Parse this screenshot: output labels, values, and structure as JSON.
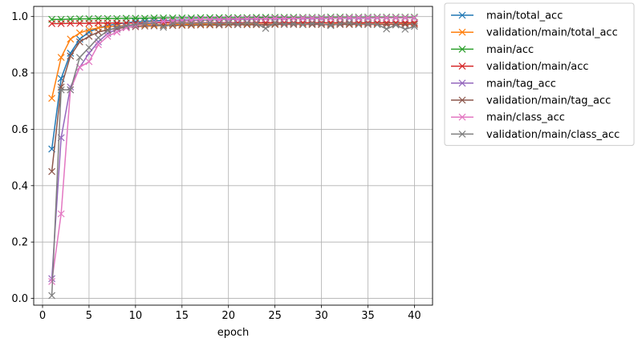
{
  "chart_data": {
    "type": "line",
    "title": "",
    "xlabel": "epoch",
    "ylabel": "",
    "xlim": [
      -0.95,
      41.95
    ],
    "ylim": [
      -0.024,
      1.036
    ],
    "xticks": [
      0,
      5,
      10,
      15,
      20,
      25,
      30,
      35,
      40
    ],
    "yticks": [
      0.0,
      0.2,
      0.4,
      0.6,
      0.8,
      1.0
    ],
    "grid": true,
    "marker": "x",
    "legend_position": "outside upper right",
    "x": [
      1,
      2,
      3,
      4,
      5,
      6,
      7,
      8,
      9,
      10,
      11,
      12,
      13,
      14,
      15,
      16,
      17,
      18,
      19,
      20,
      21,
      22,
      23,
      24,
      25,
      26,
      27,
      28,
      29,
      30,
      31,
      32,
      33,
      34,
      35,
      36,
      37,
      38,
      39,
      40
    ],
    "series": [
      {
        "name": "main/total_acc",
        "color": "#1f77b4",
        "values": [
          0.53,
          0.78,
          0.87,
          0.92,
          0.945,
          0.96,
          0.968,
          0.974,
          0.978,
          0.981,
          0.983,
          0.985,
          0.986,
          0.987,
          0.988,
          0.989,
          0.99,
          0.99,
          0.991,
          0.991,
          0.992,
          0.992,
          0.992,
          0.993,
          0.993,
          0.993,
          0.994,
          0.994,
          0.994,
          0.994,
          0.995,
          0.995,
          0.995,
          0.995,
          0.995,
          0.996,
          0.996,
          0.996,
          0.996,
          0.996
        ]
      },
      {
        "name": "validation/main/total_acc",
        "color": "#ff7f0e",
        "values": [
          0.71,
          0.855,
          0.92,
          0.942,
          0.953,
          0.96,
          0.964,
          0.966,
          0.968,
          0.97,
          0.971,
          0.972,
          0.971,
          0.973,
          0.972,
          0.973,
          0.974,
          0.973,
          0.974,
          0.972,
          0.973,
          0.975,
          0.973,
          0.972,
          0.974,
          0.973,
          0.975,
          0.973,
          0.974,
          0.972,
          0.973,
          0.974,
          0.973,
          0.975,
          0.973,
          0.974,
          0.972,
          0.973,
          0.974,
          0.973
        ]
      },
      {
        "name": "main/acc",
        "color": "#2ca02c",
        "values": [
          0.99,
          0.99,
          0.991,
          0.992,
          0.992,
          0.993,
          0.993,
          0.993,
          0.994,
          0.994,
          0.994,
          0.995,
          0.995,
          0.995,
          0.995,
          0.995,
          0.996,
          0.996,
          0.996,
          0.996,
          0.996,
          0.996,
          0.997,
          0.997,
          0.997,
          0.997,
          0.997,
          0.997,
          0.997,
          0.997,
          0.998,
          0.998,
          0.998,
          0.998,
          0.998,
          0.998,
          0.998,
          0.998,
          0.998,
          0.998
        ]
      },
      {
        "name": "validation/main/acc",
        "color": "#d62728",
        "values": [
          0.975,
          0.975,
          0.976,
          0.976,
          0.976,
          0.977,
          0.977,
          0.977,
          0.977,
          0.977,
          0.977,
          0.978,
          0.978,
          0.978,
          0.978,
          0.978,
          0.978,
          0.978,
          0.978,
          0.978,
          0.978,
          0.978,
          0.978,
          0.978,
          0.978,
          0.978,
          0.978,
          0.978,
          0.978,
          0.978,
          0.978,
          0.978,
          0.978,
          0.978,
          0.978,
          0.978,
          0.978,
          0.978,
          0.978,
          0.978
        ]
      },
      {
        "name": "main/tag_acc",
        "color": "#9467bd",
        "values": [
          0.07,
          0.57,
          0.75,
          0.82,
          0.87,
          0.91,
          0.94,
          0.955,
          0.965,
          0.972,
          0.977,
          0.98,
          0.982,
          0.984,
          0.985,
          0.986,
          0.987,
          0.988,
          0.989,
          0.99,
          0.99,
          0.991,
          0.991,
          0.992,
          0.992,
          0.992,
          0.993,
          0.993,
          0.993,
          0.993,
          0.994,
          0.994,
          0.994,
          0.994,
          0.994,
          0.995,
          0.995,
          0.995,
          0.995,
          0.995
        ]
      },
      {
        "name": "validation/main/tag_acc",
        "color": "#8c564b",
        "values": [
          0.45,
          0.75,
          0.86,
          0.91,
          0.93,
          0.945,
          0.953,
          0.958,
          0.962,
          0.964,
          0.966,
          0.967,
          0.968,
          0.968,
          0.969,
          0.969,
          0.97,
          0.97,
          0.97,
          0.971,
          0.971,
          0.971,
          0.971,
          0.972,
          0.972,
          0.972,
          0.972,
          0.972,
          0.972,
          0.972,
          0.972,
          0.972,
          0.972,
          0.972,
          0.972,
          0.972,
          0.972,
          0.972,
          0.972,
          0.972
        ]
      },
      {
        "name": "main/class_acc",
        "color": "#e377c2",
        "values": [
          0.06,
          0.3,
          0.74,
          0.82,
          0.84,
          0.9,
          0.93,
          0.945,
          0.96,
          0.968,
          0.975,
          0.98,
          0.983,
          0.985,
          0.987,
          0.988,
          0.99,
          0.99,
          0.991,
          0.992,
          0.992,
          0.993,
          0.993,
          0.993,
          0.994,
          0.994,
          0.994,
          0.995,
          0.995,
          0.995,
          0.995,
          0.995,
          0.996,
          0.996,
          0.996,
          0.996,
          0.996,
          0.996,
          0.996,
          0.996
        ]
      },
      {
        "name": "validation/main/class_acc",
        "color": "#7f7f7f",
        "values": [
          0.01,
          0.74,
          0.74,
          0.855,
          0.89,
          0.925,
          0.95,
          0.962,
          0.968,
          0.972,
          0.975,
          0.977,
          0.962,
          0.975,
          0.978,
          0.976,
          0.977,
          0.978,
          0.974,
          0.978,
          0.973,
          0.978,
          0.975,
          0.958,
          0.978,
          0.973,
          0.975,
          0.971,
          0.976,
          0.974,
          0.968,
          0.975,
          0.978,
          0.972,
          0.974,
          0.972,
          0.956,
          0.97,
          0.955,
          0.965
        ]
      }
    ]
  }
}
